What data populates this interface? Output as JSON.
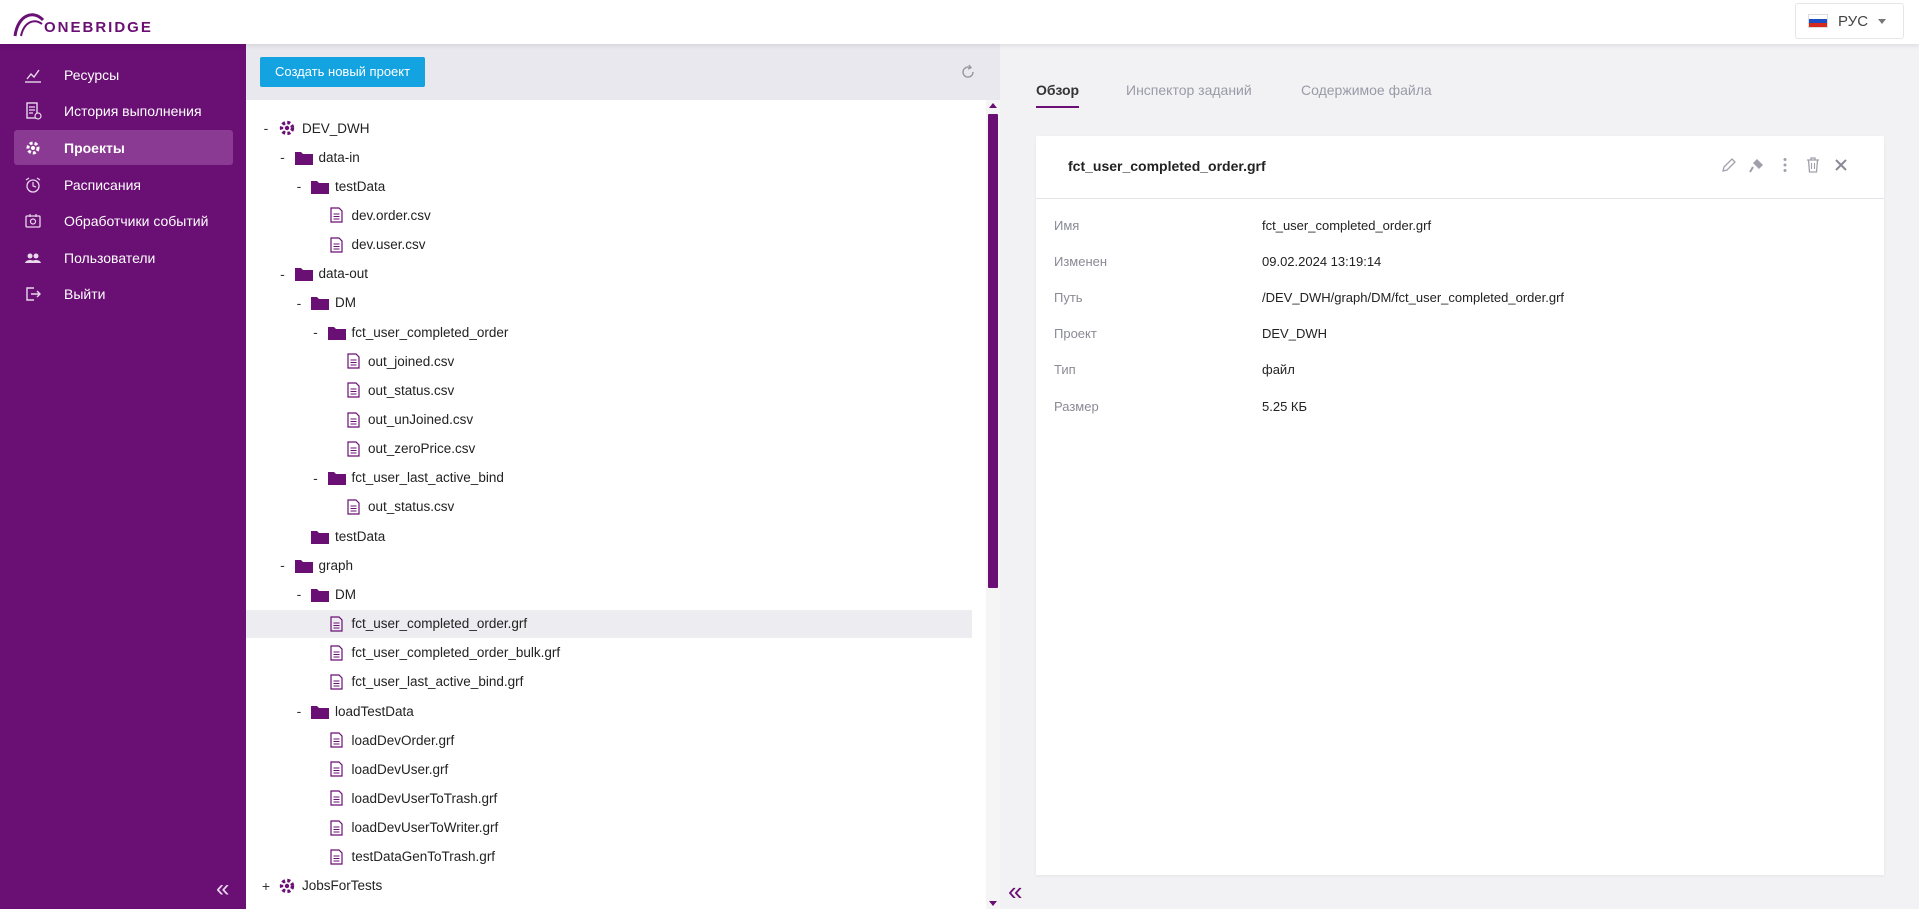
{
  "logo": {
    "text": "ONEBRIDGE"
  },
  "language": {
    "label": "РУС"
  },
  "sidebar": {
    "items": [
      {
        "label": "Ресурсы",
        "icon": "chart-icon",
        "active": false
      },
      {
        "label": "История выполнения",
        "icon": "history-icon",
        "active": false
      },
      {
        "label": "Проекты",
        "icon": "gear-icon",
        "active": true
      },
      {
        "label": "Расписания",
        "icon": "alarm-clock-icon",
        "active": false
      },
      {
        "label": "Обработчики событий",
        "icon": "event-handler-icon",
        "active": false
      },
      {
        "label": "Пользователи",
        "icon": "users-icon",
        "active": false
      },
      {
        "label": "Выйти",
        "icon": "logout-icon",
        "active": false
      }
    ],
    "collapse": "«"
  },
  "toolbar": {
    "create_label": "Создать новый проект"
  },
  "tree": {
    "nodes": [
      {
        "label": "DEV_DWH",
        "type": "project",
        "toggle": "-",
        "depth": 0
      },
      {
        "label": "data-in",
        "type": "folder",
        "toggle": "-",
        "depth": 1
      },
      {
        "label": "testData",
        "type": "folder",
        "toggle": "-",
        "depth": 2
      },
      {
        "label": "dev.order.csv",
        "type": "file",
        "toggle": "",
        "depth": 3
      },
      {
        "label": "dev.user.csv",
        "type": "file",
        "toggle": "",
        "depth": 3
      },
      {
        "label": "data-out",
        "type": "folder",
        "toggle": "-",
        "depth": 1
      },
      {
        "label": "DM",
        "type": "folder",
        "toggle": "-",
        "depth": 2
      },
      {
        "label": "fct_user_completed_order",
        "type": "folder",
        "toggle": "-",
        "depth": 3
      },
      {
        "label": "out_joined.csv",
        "type": "file",
        "toggle": "",
        "depth": 4
      },
      {
        "label": "out_status.csv",
        "type": "file",
        "toggle": "",
        "depth": 4
      },
      {
        "label": "out_unJoined.csv",
        "type": "file",
        "toggle": "",
        "depth": 4
      },
      {
        "label": "out_zeroPrice.csv",
        "type": "file",
        "toggle": "",
        "depth": 4
      },
      {
        "label": "fct_user_last_active_bind",
        "type": "folder",
        "toggle": "-",
        "depth": 3
      },
      {
        "label": "out_status.csv",
        "type": "file",
        "toggle": "",
        "depth": 4
      },
      {
        "label": "testData",
        "type": "folder",
        "toggle": "",
        "depth": 2
      },
      {
        "label": "graph",
        "type": "folder",
        "toggle": "-",
        "depth": 1
      },
      {
        "label": "DM",
        "type": "folder",
        "toggle": "-",
        "depth": 2
      },
      {
        "label": "fct_user_completed_order.grf",
        "type": "file",
        "toggle": "",
        "depth": 3,
        "selected": true
      },
      {
        "label": "fct_user_completed_order_bulk.grf",
        "type": "file",
        "toggle": "",
        "depth": 3
      },
      {
        "label": "fct_user_last_active_bind.grf",
        "type": "file",
        "toggle": "",
        "depth": 3
      },
      {
        "label": "loadTestData",
        "type": "folder",
        "toggle": "-",
        "depth": 2
      },
      {
        "label": "loadDevOrder.grf",
        "type": "file",
        "toggle": "",
        "depth": 3
      },
      {
        "label": "loadDevUser.grf",
        "type": "file",
        "toggle": "",
        "depth": 3
      },
      {
        "label": "loadDevUserToTrash.grf",
        "type": "file",
        "toggle": "",
        "depth": 3
      },
      {
        "label": "loadDevUserToWriter.grf",
        "type": "file",
        "toggle": "",
        "depth": 3
      },
      {
        "label": "testDataGenToTrash.grf",
        "type": "file",
        "toggle": "",
        "depth": 3
      },
      {
        "label": "JobsForTests",
        "type": "project",
        "toggle": "+",
        "depth": 0
      }
    ]
  },
  "tabs": [
    {
      "label": "Обзор",
      "active": true
    },
    {
      "label": "Инспектор заданий",
      "active": false
    },
    {
      "label": "Содержимое файла",
      "active": false
    }
  ],
  "details": {
    "title": "fct_user_completed_order.grf",
    "actions": [
      "edit-icon",
      "brush-icon",
      "more-icon",
      "trash-icon",
      "close-icon"
    ],
    "properties": [
      {
        "key": "Имя",
        "value": "fct_user_completed_order.grf"
      },
      {
        "key": "Изменен",
        "value": "09.02.2024 13:19:14"
      },
      {
        "key": "Путь",
        "value": "/DEV_DWH/graph/DM/fct_user_completed_order.grf"
      },
      {
        "key": "Проект",
        "value": "DEV_DWH"
      },
      {
        "key": "Тип",
        "value": "файл"
      },
      {
        "key": "Размер",
        "value": "5.25 КБ"
      }
    ]
  },
  "colors": {
    "sidebar": "#6a0f74",
    "sidebar_active": "#8a3a92",
    "primary_button": "#13a3e0",
    "folder": "#6a0f74"
  }
}
